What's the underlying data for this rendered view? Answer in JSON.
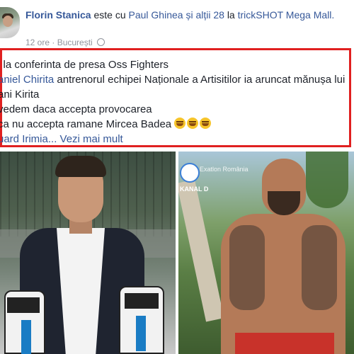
{
  "header": {
    "author": "Florin Stanica",
    "est_cu": "este cu",
    "tagged": "Paul Ghinea",
    "si_altii": "și alții 28",
    "la": "la",
    "place": "trickSHOT Mega Mall.",
    "time": "12 ore",
    "location": "București"
  },
  "post": {
    "line1": "i la conferinta de presa Oss Fighters",
    "line2_name": "aniel Chirita",
    "line2_rest": " antrenorul echipei Naționale a Artisitilor ia aruncat mănușa lui",
    "line3": "ani Kirita",
    "line4": "vedem daca accepta provocarea",
    "line5": "ca nu accepta ramane Mircea Badea",
    "line6_name": "uard Irimia",
    "line6_more": "... Vezi mai mult"
  },
  "photos": {
    "right_channel": "KANAL D",
    "right_show": "Exatlon România"
  },
  "colors": {
    "link": "#365899",
    "highlight_border": "#e02020",
    "text": "#1d2129",
    "meta": "#90949c"
  }
}
